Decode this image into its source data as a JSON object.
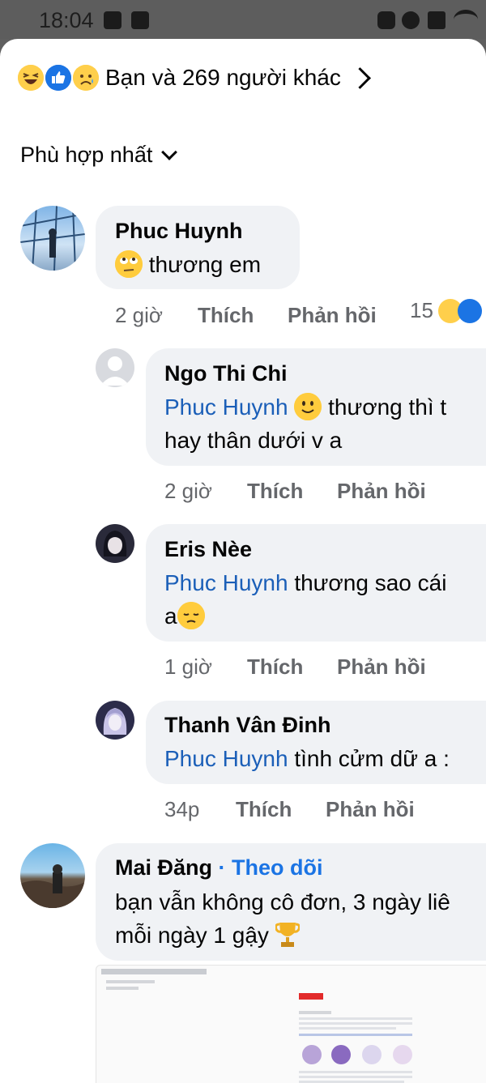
{
  "status_bar": {
    "time": "18:04"
  },
  "reactions_summary": {
    "text": "Bạn và 269 người khác"
  },
  "sort": {
    "label": "Phù hợp nhất"
  },
  "comments": [
    {
      "name": "Phuc Huynh",
      "text": "thương em",
      "time": "2 giờ",
      "like": "Thích",
      "reply": "Phản hồi",
      "reaction_count": "15"
    },
    {
      "name": "Ngo Thi Chi",
      "mention": "Phuc Huynh",
      "text_line1": "thương thì t",
      "text_line2": "hay thân dưới v a",
      "time": "2 giờ",
      "like": "Thích",
      "reply": "Phản hồi"
    },
    {
      "name": "Eris Nèe",
      "mention": "Phuc Huynh",
      "text_line1": "thương sao cái",
      "text_line2": "a",
      "time": "1 giờ",
      "like": "Thích",
      "reply": "Phản hồi"
    },
    {
      "name": "Thanh Vân Đinh",
      "mention": "Phuc Huynh",
      "text_line1": "tình cửm dữ a :",
      "time": "34p",
      "like": "Thích",
      "reply": "Phản hồi"
    },
    {
      "name": "Mai Đăng",
      "follow": "Theo dõi",
      "text_line1": "bạn vẫn không cô đơn, 3 ngày liê",
      "text_line2": "mỗi ngày 1 gậy"
    }
  ],
  "colors": {
    "mention": "#1b5fb8",
    "bubble": "#f0f2f5",
    "meta": "#65676b",
    "follow": "#1b74e4"
  }
}
